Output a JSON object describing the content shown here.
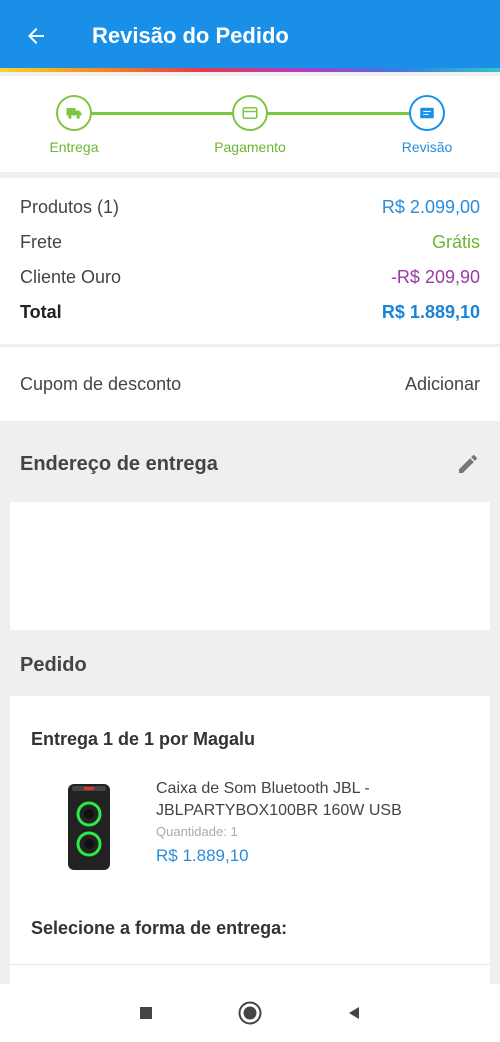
{
  "header": {
    "title": "Revisão do Pedido"
  },
  "steps": [
    {
      "label": "Entrega",
      "icon": "truck-icon",
      "state": "done"
    },
    {
      "label": "Pagamento",
      "icon": "credit-card-icon",
      "state": "done"
    },
    {
      "label": "Revisão",
      "icon": "review-list-icon",
      "state": "active"
    }
  ],
  "summary": {
    "products_label": "Produtos (1)",
    "products_value": "R$ 2.099,00",
    "shipping_label": "Frete",
    "shipping_value": "Grátis",
    "gold_label": "Cliente Ouro",
    "gold_value": "-R$ 209,90",
    "total_label": "Total",
    "total_value": "R$ 1.889,10"
  },
  "coupon": {
    "label": "Cupom de desconto",
    "action": "Adicionar"
  },
  "address": {
    "title": "Endereço de entrega"
  },
  "order": {
    "title": "Pedido",
    "delivery_label": "Entrega 1 de 1 por Magalu",
    "product": {
      "name": "Caixa de Som Bluetooth JBL - JBLPARTYBOX100BR 160W USB",
      "quantity": "Quantidade:  1",
      "price": "R$ 1.889,10"
    },
    "select_shipping": "Selecione a forma de entrega:"
  },
  "colors": {
    "primary": "#1a8fe8",
    "success": "#7ec641",
    "discount": "#9b3aa6"
  }
}
